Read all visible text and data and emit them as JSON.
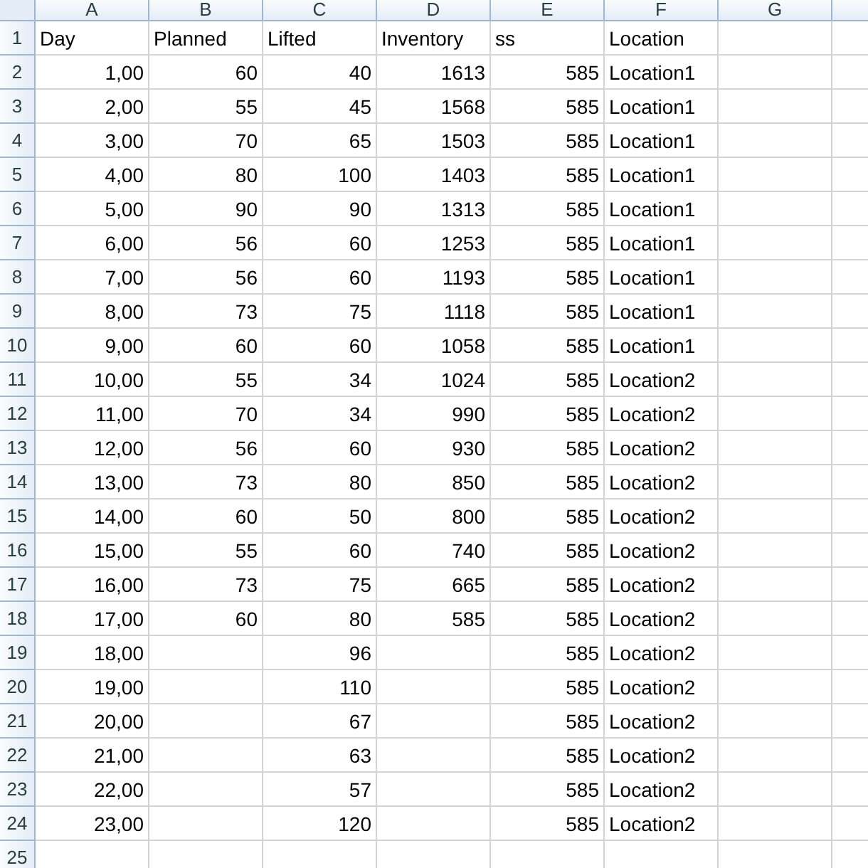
{
  "columns": [
    {
      "label": "A",
      "kind": "number"
    },
    {
      "label": "B",
      "kind": "number"
    },
    {
      "label": "C",
      "kind": "number"
    },
    {
      "label": "D",
      "kind": "number"
    },
    {
      "label": "E",
      "kind": "number"
    },
    {
      "label": "F",
      "kind": "text"
    },
    {
      "label": "G"
    }
  ],
  "rows": [
    {
      "number": "1",
      "kind": "header",
      "cells": [
        "Day",
        "Planned",
        "Lifted",
        "Inventory",
        "ss",
        "Location",
        null
      ]
    },
    {
      "number": "2",
      "kind": "data",
      "cells": [
        "1,00",
        "60",
        "40",
        "1613",
        "585",
        "Location1",
        null
      ]
    },
    {
      "number": "3",
      "kind": "data",
      "cells": [
        "2,00",
        "55",
        "45",
        "1568",
        "585",
        "Location1",
        null
      ]
    },
    {
      "number": "4",
      "kind": "data",
      "cells": [
        "3,00",
        "70",
        "65",
        "1503",
        "585",
        "Location1",
        null
      ]
    },
    {
      "number": "5",
      "kind": "data",
      "cells": [
        "4,00",
        "80",
        "100",
        "1403",
        "585",
        "Location1",
        null
      ]
    },
    {
      "number": "6",
      "kind": "data",
      "cells": [
        "5,00",
        "90",
        "90",
        "1313",
        "585",
        "Location1",
        null
      ]
    },
    {
      "number": "7",
      "kind": "data",
      "cells": [
        "6,00",
        "56",
        "60",
        "1253",
        "585",
        "Location1",
        null
      ]
    },
    {
      "number": "8",
      "kind": "data",
      "cells": [
        "7,00",
        "56",
        "60",
        "1193",
        "585",
        "Location1",
        null
      ]
    },
    {
      "number": "9",
      "kind": "data",
      "cells": [
        "8,00",
        "73",
        "75",
        "1118",
        "585",
        "Location1",
        null
      ]
    },
    {
      "number": "10",
      "kind": "data",
      "cells": [
        "9,00",
        "60",
        "60",
        "1058",
        "585",
        "Location1",
        null
      ]
    },
    {
      "number": "11",
      "kind": "data",
      "cells": [
        "10,00",
        "55",
        "34",
        "1024",
        "585",
        "Location2",
        null
      ]
    },
    {
      "number": "12",
      "kind": "data",
      "cells": [
        "11,00",
        "70",
        "34",
        "990",
        "585",
        "Location2",
        null
      ]
    },
    {
      "number": "13",
      "kind": "data",
      "cells": [
        "12,00",
        "56",
        "60",
        "930",
        "585",
        "Location2",
        null
      ]
    },
    {
      "number": "14",
      "kind": "data",
      "cells": [
        "13,00",
        "73",
        "80",
        "850",
        "585",
        "Location2",
        null
      ]
    },
    {
      "number": "15",
      "kind": "data",
      "cells": [
        "14,00",
        "60",
        "50",
        "800",
        "585",
        "Location2",
        null
      ]
    },
    {
      "number": "16",
      "kind": "data",
      "cells": [
        "15,00",
        "55",
        "60",
        "740",
        "585",
        "Location2",
        null
      ]
    },
    {
      "number": "17",
      "kind": "data",
      "cells": [
        "16,00",
        "73",
        "75",
        "665",
        "585",
        "Location2",
        null
      ]
    },
    {
      "number": "18",
      "kind": "data",
      "cells": [
        "17,00",
        "60",
        "80",
        "585",
        "585",
        "Location2",
        null
      ]
    },
    {
      "number": "19",
      "kind": "data",
      "cells": [
        "18,00",
        null,
        "96",
        null,
        "585",
        "Location2",
        null
      ]
    },
    {
      "number": "20",
      "kind": "data",
      "cells": [
        "19,00",
        null,
        "110",
        null,
        "585",
        "Location2",
        null
      ]
    },
    {
      "number": "21",
      "kind": "data",
      "cells": [
        "20,00",
        null,
        "67",
        null,
        "585",
        "Location2",
        null
      ]
    },
    {
      "number": "22",
      "kind": "data",
      "cells": [
        "21,00",
        null,
        "63",
        null,
        "585",
        "Location2",
        null
      ]
    },
    {
      "number": "23",
      "kind": "data",
      "cells": [
        "22,00",
        null,
        "57",
        null,
        "585",
        "Location2",
        null
      ]
    },
    {
      "number": "24",
      "kind": "data",
      "cells": [
        "23,00",
        null,
        "120",
        null,
        "585",
        "Location2",
        null
      ]
    },
    {
      "number": "25"
    }
  ]
}
